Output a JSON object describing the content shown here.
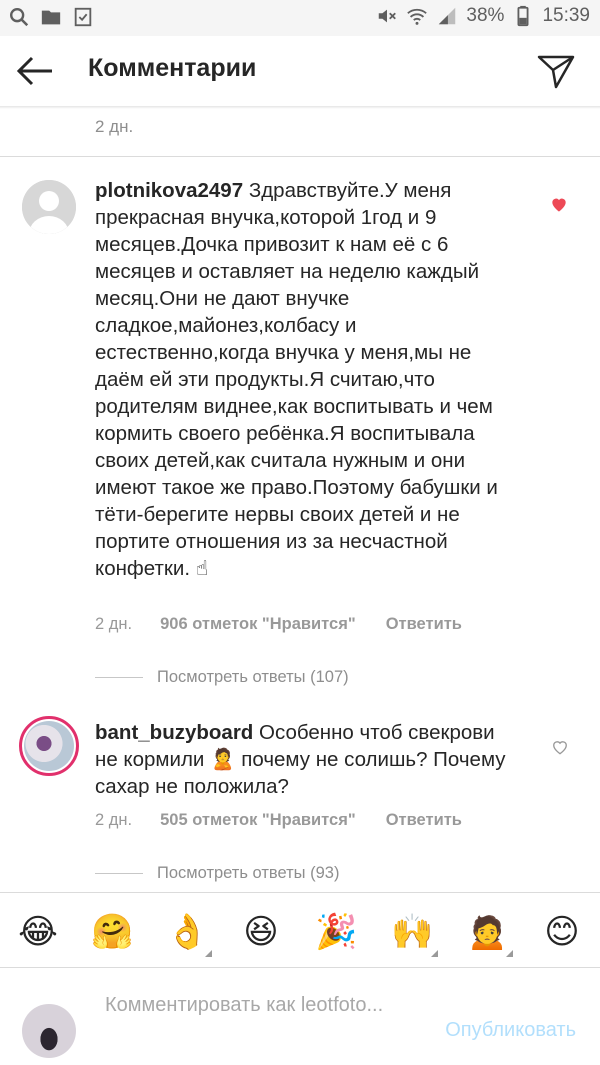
{
  "status_bar": {
    "battery": "38%",
    "time": "15:39"
  },
  "header": {
    "title": "Комментарии"
  },
  "top_comment_time": "2 дн.",
  "comments": [
    {
      "username": "plotnikova2497",
      "text": "Здравствуйте.У меня прекрасная внучка,которой 1год и 9 месяцев.Дочка привозит к нам её с 6 месяцев и оставляет на неделю каждый месяц.Они не дают внучке сладкое,майонез,колбасу и естественно,когда внучка у меня,мы не даём ей эти продукты.Я считаю,что родителям виднее,как воспитывать и чем кормить своего ребёнка.Я воспитывала своих детей,как считала нужным и они имеют такое же право.Поэтому  бабушки и тёти-берегите нервы своих детей и не портите отношения из за несчастной конфетки. ☝",
      "time": "2 дн.",
      "likes": "906 отметок \"Нравится\"",
      "reply_label": "Ответить",
      "view_replies": "Посмотреть ответы (107)",
      "liked": true
    },
    {
      "username": "bant_buzyboard",
      "text": "Особенно чтоб свекрови не кормили 🙎 почему не солишь? Почему сахар не положила?",
      "time": "2 дн.",
      "likes": "505 отметок \"Нравится\"",
      "reply_label": "Ответить",
      "view_replies": "Посмотреть ответы (93)",
      "liked": false
    }
  ],
  "emoji_bar": [
    "😂",
    "🤗",
    "👌",
    "😆",
    "🎉",
    "🙌",
    "🙍",
    "😊"
  ],
  "input": {
    "placeholder": "Комментировать как leotfoto...",
    "publish_label": "Опубликовать"
  },
  "colors": {
    "heart_liked": "#ed4956",
    "publish_disabled": "#b2dffc",
    "muted_text": "#8e8e8e"
  }
}
